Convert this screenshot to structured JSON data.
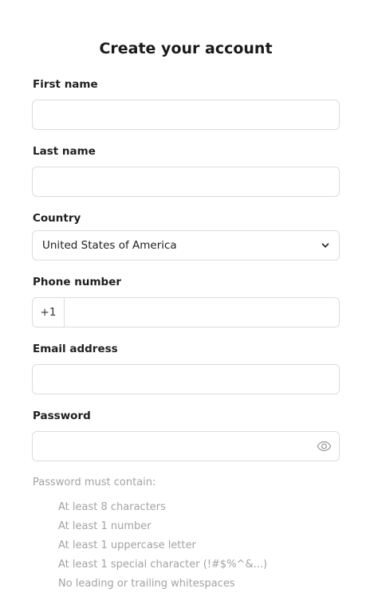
{
  "form": {
    "title": "Create your account",
    "first_name": {
      "label": "First name",
      "value": ""
    },
    "last_name": {
      "label": "Last name",
      "value": ""
    },
    "country": {
      "label": "Country",
      "selected": "United States of America"
    },
    "phone": {
      "label": "Phone number",
      "prefix": "+1",
      "value": ""
    },
    "email": {
      "label": "Email address",
      "value": ""
    },
    "password": {
      "label": "Password",
      "value": ""
    }
  },
  "password_rules": {
    "heading": "Password must contain:",
    "items": [
      "At least 8 characters",
      "At least 1 number",
      "At least 1 uppercase letter",
      "At least 1 special character (!#$%^&...)",
      "No leading or trailing whitespaces"
    ]
  },
  "icons": {
    "country_select": "chevron-down-icon",
    "password_toggle": "eye-icon"
  }
}
